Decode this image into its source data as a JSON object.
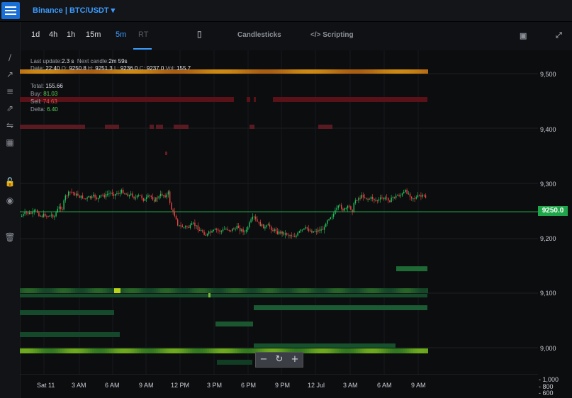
{
  "header": {
    "exchange_pair": "Binance | BTC/USDT"
  },
  "timeframes": [
    {
      "label": "1d"
    },
    {
      "label": "4h"
    },
    {
      "label": "1h"
    },
    {
      "label": "15m"
    },
    {
      "label": "5m"
    },
    {
      "label": "RT"
    }
  ],
  "active_timeframe": "5m",
  "toolbar": {
    "candlesticks_label": "Candlesticks",
    "scripting_label": "</> Scripting"
  },
  "info": {
    "last_update_label": "Last update:",
    "last_update_value": "2.3 s",
    "next_candle_label": "Next candle:",
    "next_candle_value": "2m 59s",
    "date_label": "Date:",
    "date_value": "22:40",
    "o_label": "O:",
    "o_value": "9250.8",
    "h_label": "H:",
    "h_value": "9251.3",
    "l_label": "L:",
    "l_value": "9236.0",
    "c_label": "C:",
    "c_value": "9237.0",
    "vol_label": "Vol:",
    "vol_value": "155.7",
    "total_label": "Total:",
    "total_value": "155.66",
    "buy_label": "Buy:",
    "buy_value": "81.03",
    "sell_label": "Sell:",
    "sell_value": "74.63",
    "delta_label": "Delta:",
    "delta_value": "6.40"
  },
  "price_axis": [
    "9,500",
    "9,400",
    "9,300",
    "9,200",
    "9,100",
    "9,000"
  ],
  "volume_axis": [
    "- 1,000",
    "- 800",
    "- 600"
  ],
  "time_axis": [
    "Sat 11",
    "3 AM",
    "6 AM",
    "9 AM",
    "12 PM",
    "3 PM",
    "6 PM",
    "9 PM",
    "12 Jul",
    "3 AM",
    "6 AM",
    "9 AM"
  ],
  "current_price": "9250.0",
  "zoom": {
    "minus": "−",
    "reset": "↻",
    "plus": "+"
  },
  "colors": {
    "accent": "#3b9cff",
    "up": "#22c55e",
    "down": "#ef4444",
    "price_tag": "#1fa64a"
  }
}
